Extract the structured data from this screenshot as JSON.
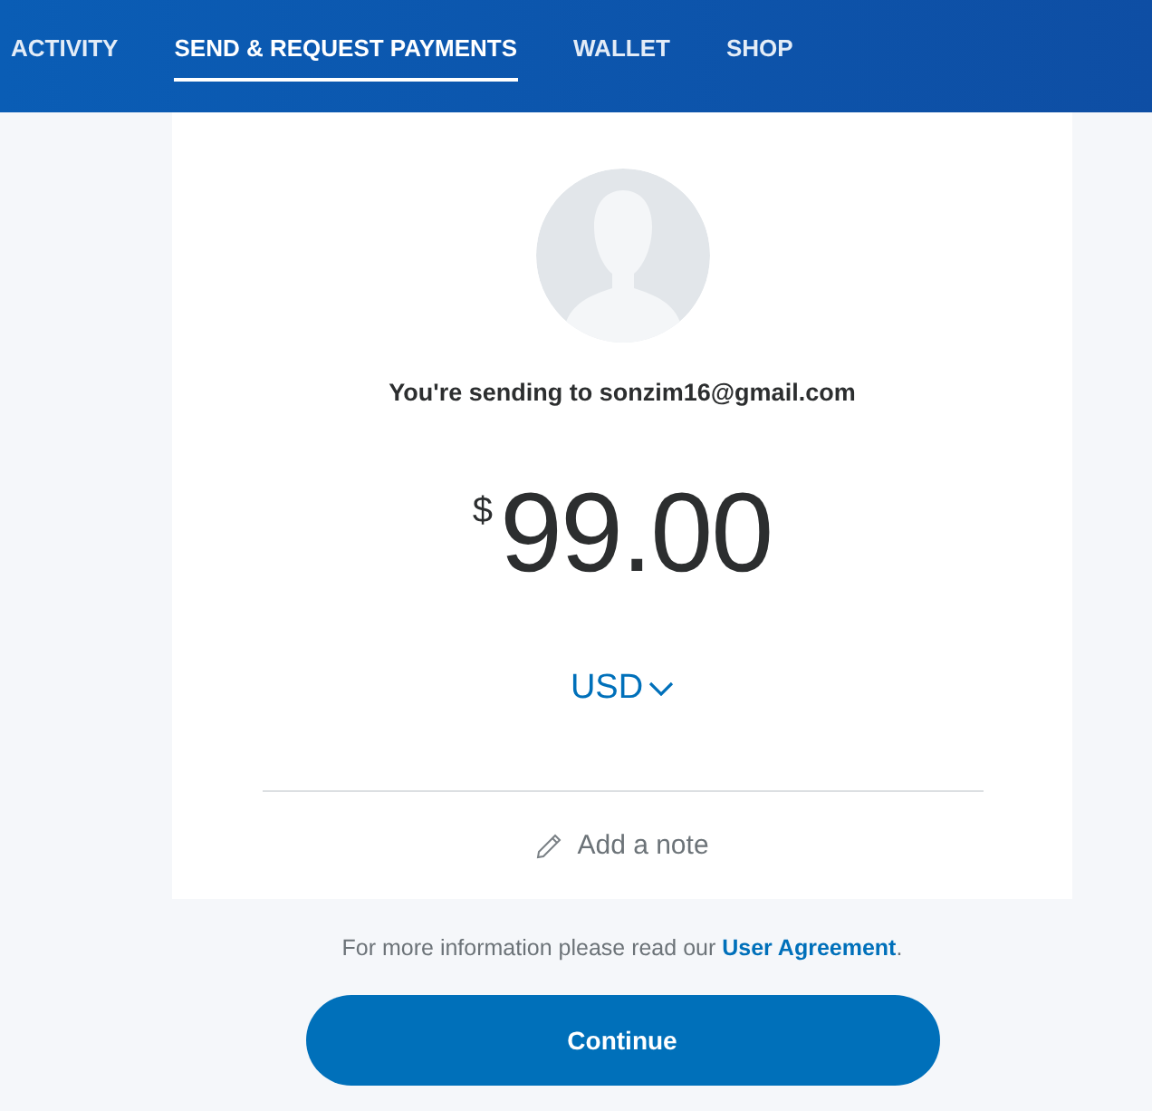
{
  "nav": {
    "tabs": [
      {
        "label": "ACTIVITY",
        "selected": false
      },
      {
        "label": "SEND & REQUEST PAYMENTS",
        "selected": true
      },
      {
        "label": "WALLET",
        "selected": false
      },
      {
        "label": "SHOP",
        "selected": false
      }
    ]
  },
  "recipient": {
    "text": "You're sending to sonzim16@gmail.com"
  },
  "amount": {
    "currency_symbol": "$",
    "value": "99.00"
  },
  "currency_selector": {
    "label": "USD"
  },
  "note": {
    "label": "Add a note"
  },
  "agreement": {
    "text": "For more information please read our",
    "link": "User Agreement",
    "end": "."
  },
  "continue_button": {
    "label": "Continue"
  }
}
